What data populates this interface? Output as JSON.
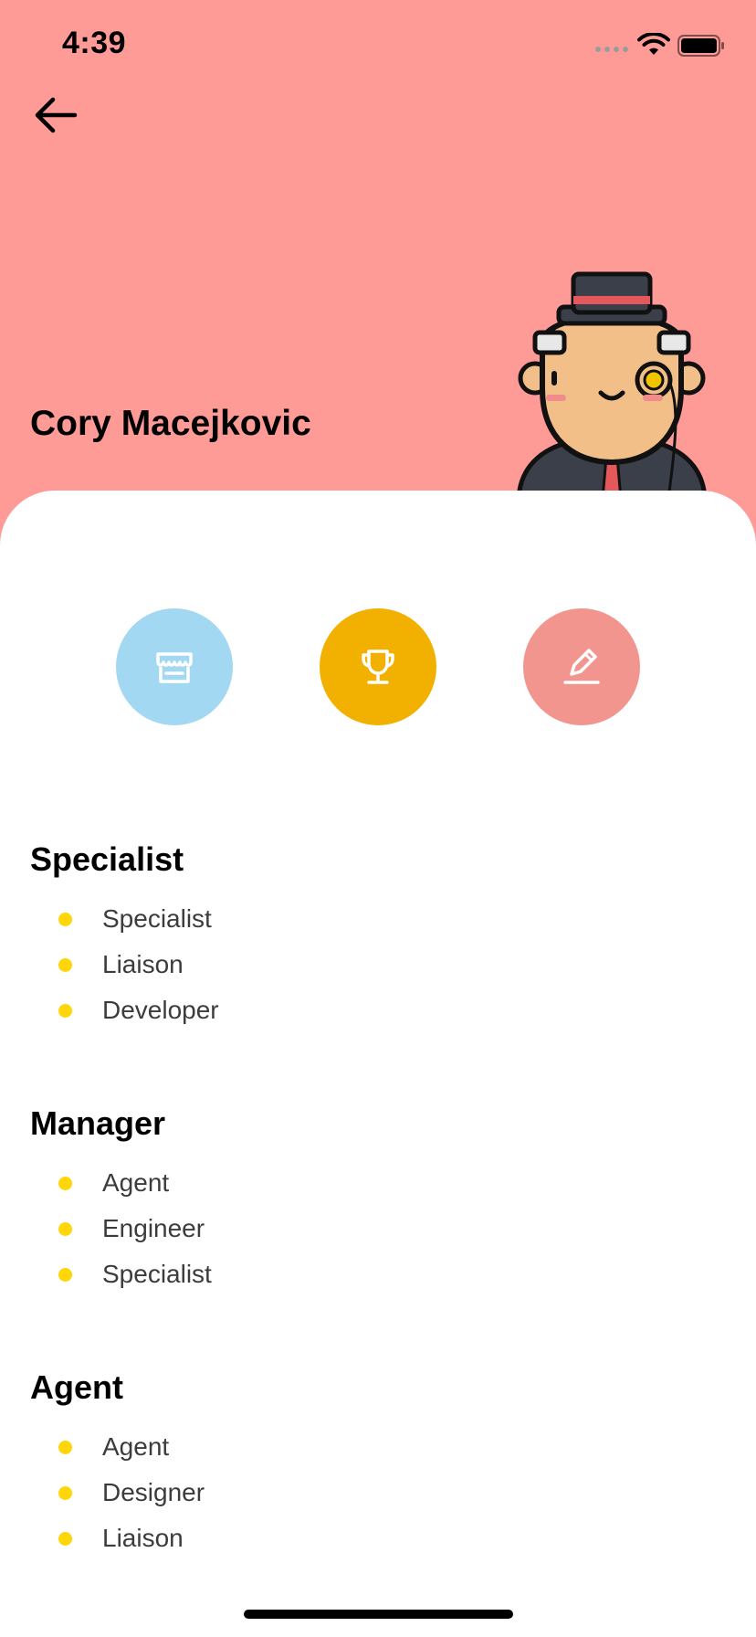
{
  "status_bar": {
    "time": "4:39"
  },
  "profile": {
    "name": "Cory Macejkovic"
  },
  "actions": [
    {
      "name": "store",
      "icon": "store-icon",
      "color": "#a3d8f2"
    },
    {
      "name": "trophy",
      "icon": "trophy-icon",
      "color": "#f2b100"
    },
    {
      "name": "edit",
      "icon": "pencil-icon",
      "color": "#f2958e"
    }
  ],
  "sections": [
    {
      "title": "Specialist",
      "items": [
        "Specialist",
        "Liaison",
        "Developer"
      ]
    },
    {
      "title": "Manager",
      "items": [
        "Agent",
        "Engineer",
        "Specialist"
      ]
    },
    {
      "title": "Agent",
      "items": [
        "Agent",
        "Designer",
        "Liaison"
      ]
    }
  ],
  "colors": {
    "header_bg": "#fe9b97",
    "bullet": "#ffd60a"
  }
}
